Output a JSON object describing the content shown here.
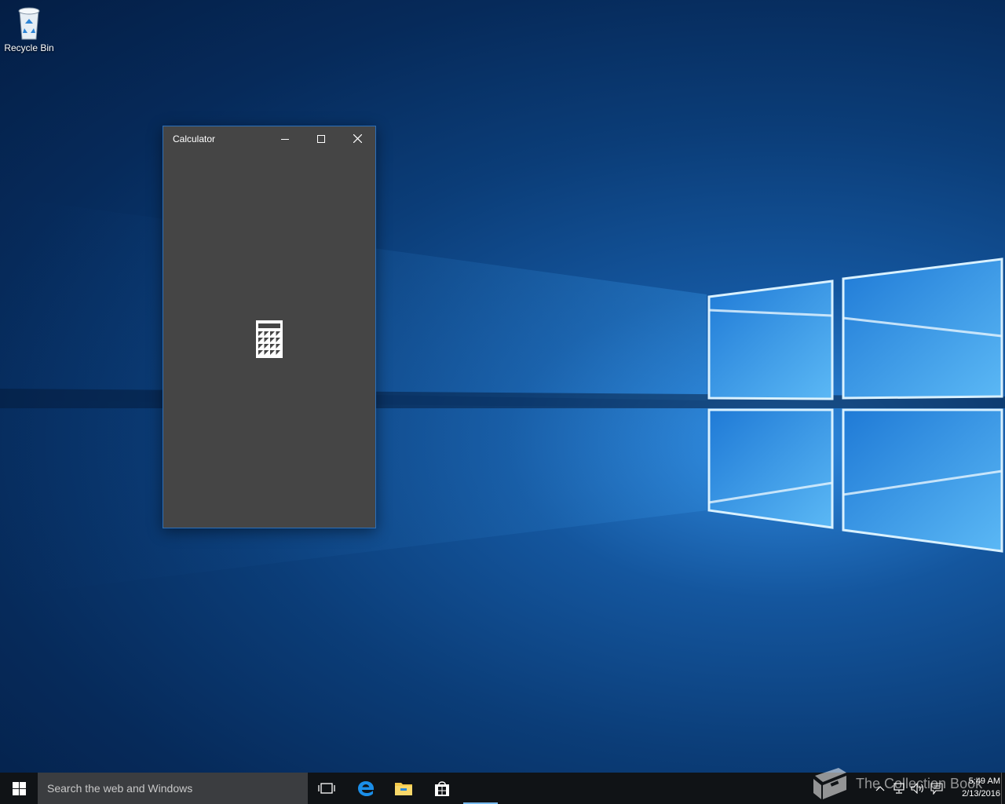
{
  "desktop": {
    "icons": [
      {
        "label": "Recycle Bin",
        "icon": "recycle-bin-icon"
      }
    ]
  },
  "window": {
    "title": "Calculator",
    "controls": {
      "minimize": "minimize-icon",
      "maximize": "maximize-icon",
      "close": "close-icon"
    },
    "splash_icon": "calculator-icon",
    "background": "#454545",
    "accent": "#2c6fb8"
  },
  "taskbar": {
    "start_icon": "windows-logo-icon",
    "search_placeholder": "Search the web and Windows",
    "pinned": [
      {
        "name": "task-view",
        "icon": "task-view-icon"
      },
      {
        "name": "edge",
        "icon": "edge-icon"
      },
      {
        "name": "file-explorer",
        "icon": "folder-icon"
      },
      {
        "name": "store",
        "icon": "store-icon"
      },
      {
        "name": "calculator",
        "icon": "calculator-icon",
        "active": true
      }
    ],
    "tray": {
      "icons": [
        "chevron-up-icon",
        "network-icon",
        "volume-icon",
        "action-center-icon"
      ],
      "time": "5:49 AM",
      "date": "2/13/2016"
    }
  },
  "watermark": {
    "text": "The Collection Book",
    "icon": "book-icon"
  }
}
